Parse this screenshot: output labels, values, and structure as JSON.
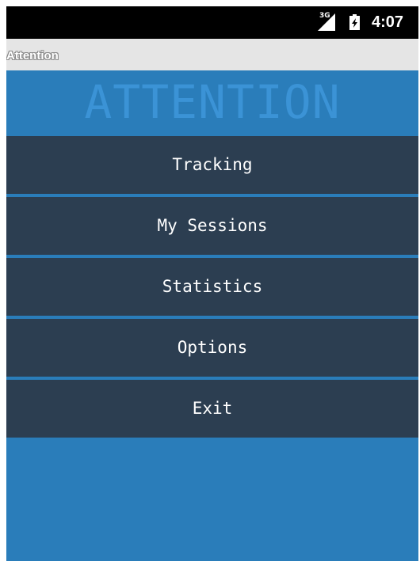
{
  "status_bar": {
    "signal_label": "3G",
    "time": "4:07",
    "signal_icon": "signal-icon",
    "battery_icon": "battery-charging-icon"
  },
  "title_bar": {
    "title": "Attention"
  },
  "banner": {
    "text": "ATTENTION"
  },
  "menu": {
    "items": [
      {
        "label": "Tracking"
      },
      {
        "label": "My Sessions"
      },
      {
        "label": "Statistics"
      },
      {
        "label": "Options"
      },
      {
        "label": "Exit"
      }
    ]
  },
  "colors": {
    "status_bar_bg": "#000000",
    "title_bar_bg": "#e5e5e5",
    "content_bg": "#2a7dba",
    "banner_text": "#3b93d6",
    "menu_item_bg": "#2c3e51",
    "menu_text": "#ffffff"
  }
}
